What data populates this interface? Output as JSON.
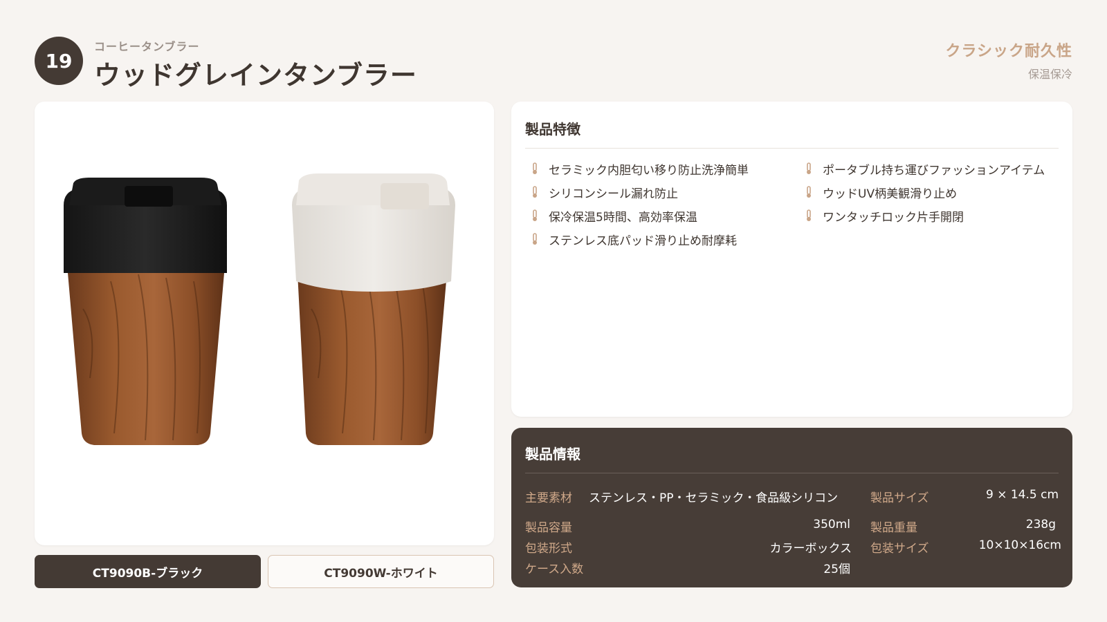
{
  "header": {
    "number": "19",
    "subtitle": "コーヒータンブラー",
    "title": "ウッドグレインタンブラー",
    "tagline_main": "クラシック耐久性",
    "tagline_sub": "保温保冷"
  },
  "variants": [
    {
      "label": "CT9090B-ブラック",
      "selected": true
    },
    {
      "label": "CT9090W-ホワイト",
      "selected": false
    }
  ],
  "features": {
    "title": "製品特徴",
    "items": [
      "セラミック内胆匂い移り防止洗浄簡単",
      "ポータブル持ち運びファッションアイテム",
      "シリコンシール漏れ防止",
      "ウッドUV柄美観滑り止め",
      "保冷保温5時間、高効率保温",
      "ワンタッチロック片手開閉",
      "ステンレス底パッド滑り止め耐摩耗"
    ],
    "icon": "thermometer-icon",
    "icon_color": "#c9a588"
  },
  "info": {
    "title": "製品情報",
    "material_label": "主要素材",
    "material_value": "ステンレス・PP・セラミック・食品級シリコン",
    "size_label": "製品サイズ",
    "size_value": "9 × 14.5 cm",
    "capacity_label": "製品容量",
    "capacity_value": "350ml",
    "weight_label": "製品重量",
    "weight_value": "238g",
    "packaging_label": "包装形式",
    "packaging_value": "カラーボックス",
    "package_size_label": "包装サイズ",
    "package_size_value": "10×10×16cm",
    "case_qty_label": "ケース入数",
    "case_qty_value": "25個"
  },
  "colors": {
    "background": "#f7f4f1",
    "dark": "#443a34",
    "accent": "#c9a588",
    "info_bg": "#473d37"
  }
}
